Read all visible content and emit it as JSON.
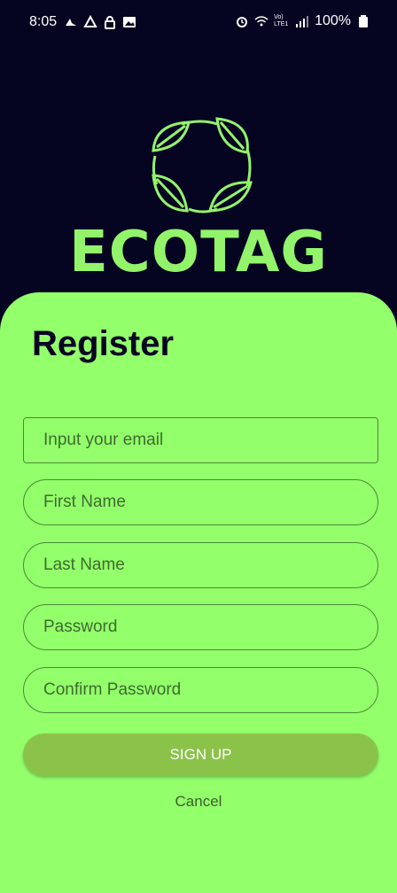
{
  "status_bar": {
    "time": "8:05",
    "battery": "100%",
    "network": "Vo) LTE1"
  },
  "logo": {
    "text": "ECOTAG",
    "color": "#93f36b"
  },
  "form": {
    "title": "Register",
    "email_placeholder": "Input your email",
    "first_name_placeholder": "First Name",
    "last_name_placeholder": "Last Name",
    "password_placeholder": "Password",
    "confirm_password_placeholder": "Confirm Password",
    "signup_label": "SIGN UP",
    "cancel_label": "Cancel"
  },
  "colors": {
    "background": "#050522",
    "card": "#93ff6b",
    "button": "#8bc34a"
  }
}
